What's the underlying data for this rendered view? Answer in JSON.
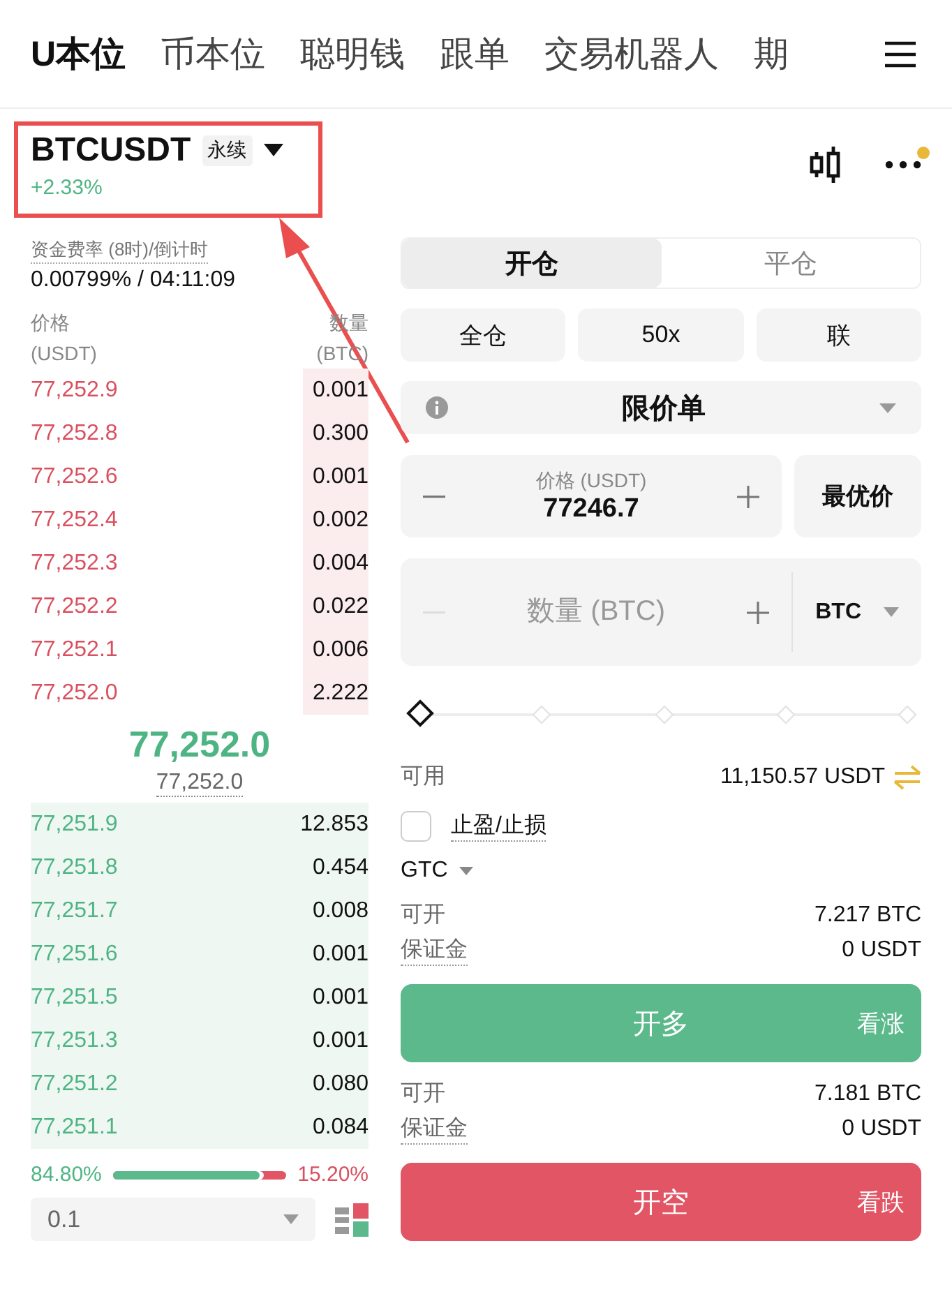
{
  "top_tabs": [
    {
      "label": "U本位",
      "selected": true
    },
    {
      "label": "币本位",
      "selected": false
    },
    {
      "label": "聪明钱",
      "selected": false
    },
    {
      "label": "跟单",
      "selected": false
    },
    {
      "label": "交易机器人",
      "selected": false
    },
    {
      "label": "期",
      "selected": false
    }
  ],
  "ticker": {
    "symbol": "BTCUSDT",
    "tag": "永续",
    "change": "+2.33%",
    "more_badge": true
  },
  "order_book": {
    "funding_label": "资金费率 (8时)/倒计时",
    "funding_value": "0.00799% / 04:11:09",
    "price_header": "价格",
    "price_unit": "(USDT)",
    "qty_header": "数量",
    "qty_unit": "(BTC)",
    "asks": [
      {
        "price": "77,252.9",
        "qty": "0.001"
      },
      {
        "price": "77,252.8",
        "qty": "0.300"
      },
      {
        "price": "77,252.6",
        "qty": "0.001"
      },
      {
        "price": "77,252.4",
        "qty": "0.002"
      },
      {
        "price": "77,252.3",
        "qty": "0.004"
      },
      {
        "price": "77,252.2",
        "qty": "0.022"
      },
      {
        "price": "77,252.1",
        "qty": "0.006"
      },
      {
        "price": "77,252.0",
        "qty": "2.222"
      }
    ],
    "last_price": "77,252.0",
    "mark_price": "77,252.0",
    "bids": [
      {
        "price": "77,251.9",
        "qty": "12.853"
      },
      {
        "price": "77,251.8",
        "qty": "0.454"
      },
      {
        "price": "77,251.7",
        "qty": "0.008"
      },
      {
        "price": "77,251.6",
        "qty": "0.001"
      },
      {
        "price": "77,251.5",
        "qty": "0.001"
      },
      {
        "price": "77,251.3",
        "qty": "0.001"
      },
      {
        "price": "77,251.2",
        "qty": "0.080"
      },
      {
        "price": "77,251.1",
        "qty": "0.084"
      }
    ],
    "buy_ratio": "84.80%",
    "sell_ratio": "15.20%",
    "level": 0.848,
    "precision": "0.1"
  },
  "trade": {
    "modes": [
      {
        "label": "开仓",
        "selected": true
      },
      {
        "label": "平仓",
        "selected": false
      }
    ],
    "settings": [
      "全仓",
      "50x",
      "联"
    ],
    "order_type": "限价单",
    "price_field": {
      "label": "价格 (USDT)",
      "value": "77246.7"
    },
    "best_price": "最优价",
    "qty_field": {
      "placeholder": "数量 (BTC)",
      "unit": "BTC",
      "minus_disabled": true
    },
    "slider": {
      "level": 0
    },
    "available_label": "可用",
    "available_value": "11,150.57 USDT",
    "tp_sl": {
      "label": "止盈/止损",
      "checked": false
    },
    "tif": "GTC",
    "long": {
      "max_label": "可开",
      "max_value": "7.217 BTC",
      "margin_label": "保证金",
      "margin_value": "0 USDT",
      "button": "开多",
      "hint": "看涨"
    },
    "short": {
      "max_label": "可开",
      "max_value": "7.181 BTC",
      "margin_label": "保证金",
      "margin_value": "0 USDT",
      "button": "开空",
      "hint": "看跌"
    }
  }
}
